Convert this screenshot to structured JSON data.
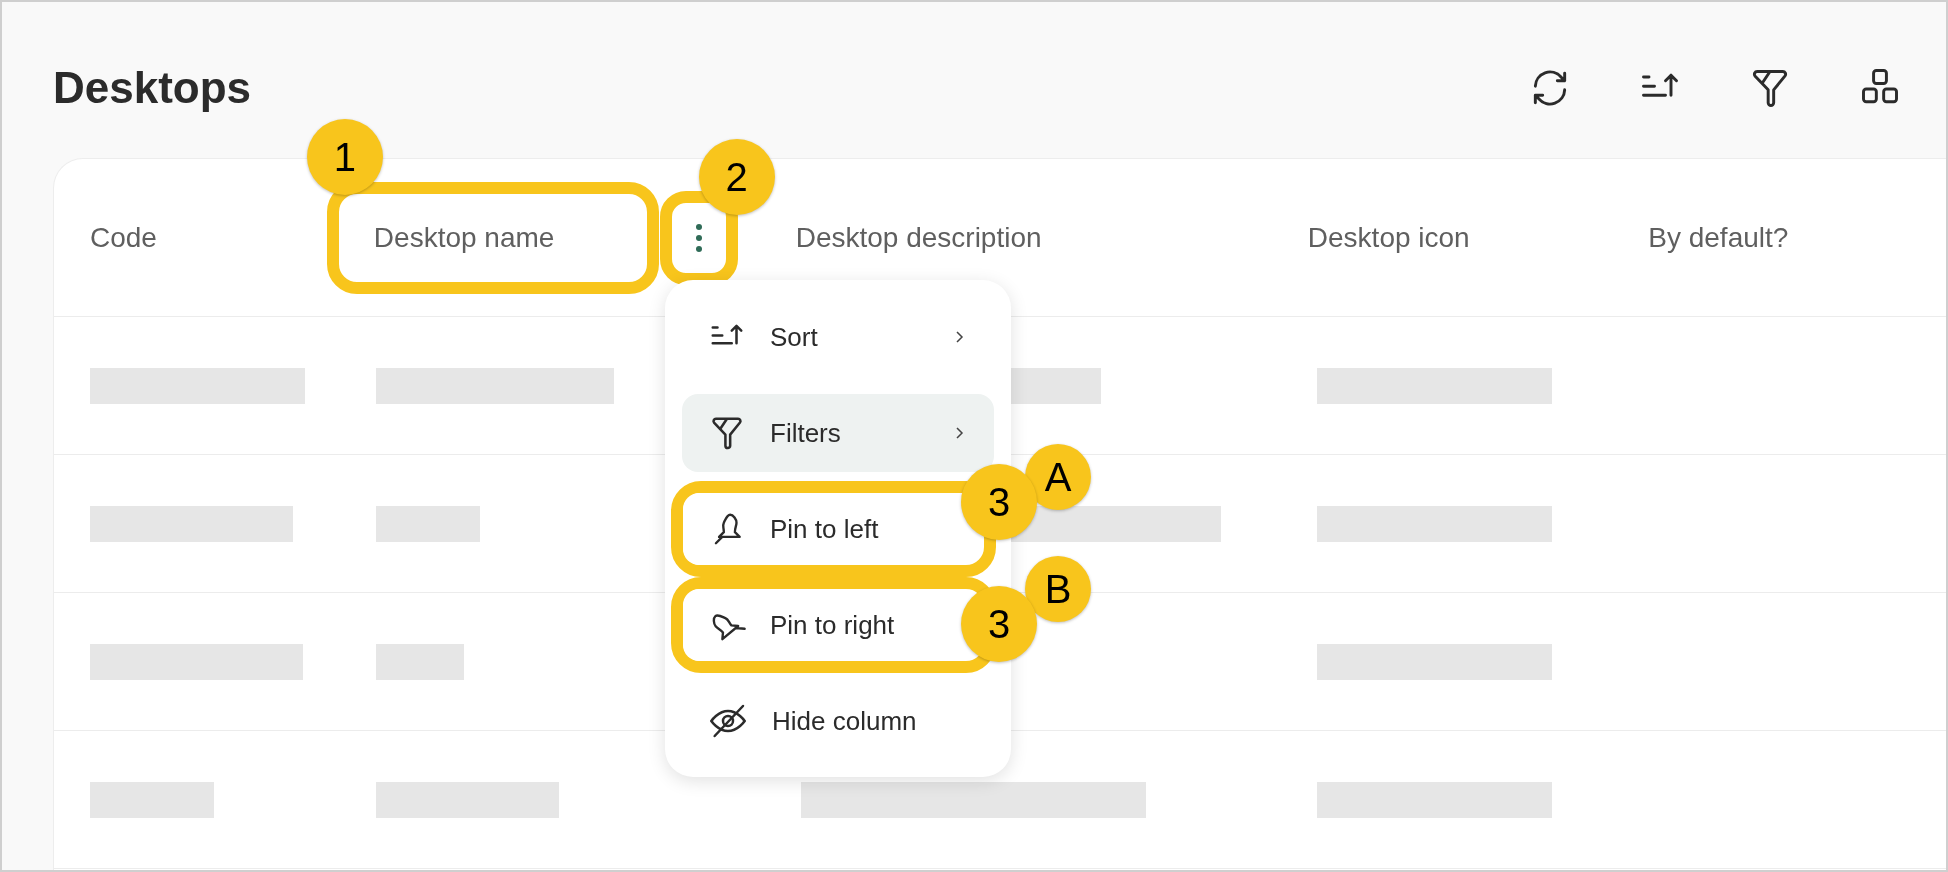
{
  "page": {
    "title": "Desktops"
  },
  "table": {
    "columns": [
      {
        "label": "Code"
      },
      {
        "label": "Desktop name",
        "callout": "1"
      },
      {
        "label": "Desktop description"
      },
      {
        "label": "Desktop icon"
      },
      {
        "label": "By default?"
      }
    ],
    "column_menu_button": {
      "callout": "2"
    }
  },
  "column_menu": {
    "items": [
      {
        "label": "Sort",
        "submenu": true,
        "selected": false
      },
      {
        "label": "Filters",
        "submenu": true,
        "selected": true
      },
      {
        "label": "Pin to left",
        "submenu": false,
        "selected": false,
        "callouts": [
          "3",
          "A"
        ]
      },
      {
        "label": "Pin to right",
        "submenu": false,
        "selected": false,
        "callouts": [
          "3",
          "B"
        ]
      },
      {
        "label": "Hide column",
        "submenu": false,
        "selected": false
      }
    ]
  }
}
